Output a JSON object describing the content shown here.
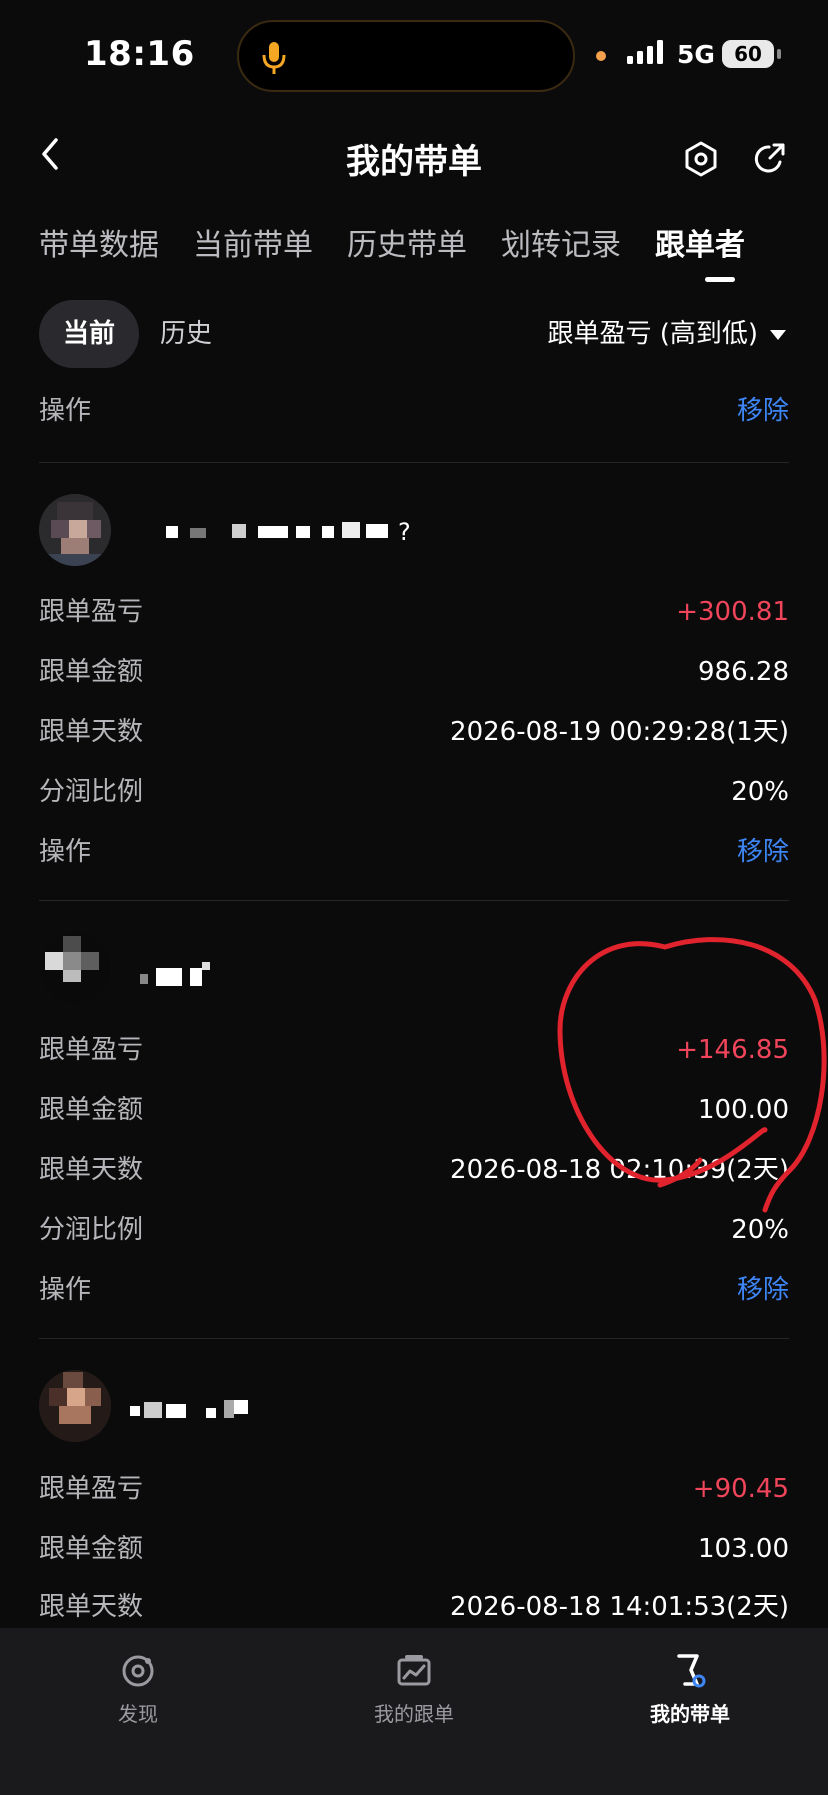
{
  "status": {
    "time": "18:16",
    "network": "5G",
    "battery": "60"
  },
  "header": {
    "title": "我的带单"
  },
  "tabs": [
    {
      "label": "带单数据"
    },
    {
      "label": "当前带单"
    },
    {
      "label": "历史带单"
    },
    {
      "label": "划转记录"
    },
    {
      "label": "跟单者"
    }
  ],
  "segment": {
    "current": "当前",
    "history": "历史"
  },
  "sort": {
    "label": "跟单盈亏 (高到低)"
  },
  "top_row": {
    "label": "操作",
    "action": "移除"
  },
  "followers": [
    {
      "rows": [
        {
          "label": "跟单盈亏",
          "value": "+300.81"
        },
        {
          "label": "跟单金额",
          "value": "986.28"
        },
        {
          "label": "跟单天数",
          "value": "2026-08-19 00:29:28(1天)"
        },
        {
          "label": "分润比例",
          "value": "20%"
        },
        {
          "label": "操作",
          "value": "移除"
        }
      ]
    },
    {
      "rows": [
        {
          "label": "跟单盈亏",
          "value": "+146.85"
        },
        {
          "label": "跟单金额",
          "value": "100.00"
        },
        {
          "label": "跟单天数",
          "value": "2026-08-18 02:10:39(2天)"
        },
        {
          "label": "分润比例",
          "value": "20%"
        },
        {
          "label": "操作",
          "value": "移除"
        }
      ]
    },
    {
      "rows": [
        {
          "label": "跟单盈亏",
          "value": "+90.45"
        },
        {
          "label": "跟单金额",
          "value": "103.00"
        },
        {
          "label": "跟单天数",
          "value": "2026-08-18 14:01:53(2天)"
        }
      ]
    }
  ],
  "bottom_nav": [
    {
      "label": "发现",
      "icon": "discover-icon"
    },
    {
      "label": "我的跟单",
      "icon": "chart-icon"
    },
    {
      "label": "我的带单",
      "icon": "flag-icon"
    }
  ],
  "colors": {
    "profit": "#f0455a",
    "action": "#3e86f5",
    "annotation": "#e0232d"
  }
}
